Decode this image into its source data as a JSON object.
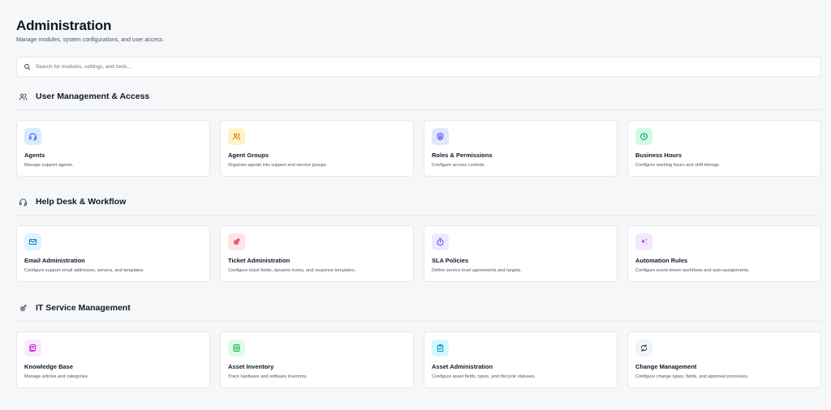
{
  "page": {
    "title": "Administration",
    "subtitle": "Manage modules, system configurations, and user access."
  },
  "search": {
    "placeholder": "Search for modules, settings, and tools..."
  },
  "sections": [
    {
      "title": "User Management & Access",
      "icon": "users-icon",
      "cards": [
        {
          "title": "Agents",
          "description": "Manage support agents.",
          "icon": "headset-icon",
          "bg": "#dbeafe",
          "color": "#2563eb"
        },
        {
          "title": "Agent Groups",
          "description": "Organize agents into support and service groups.",
          "icon": "user-group-icon",
          "bg": "#fef3c7",
          "color": "#d97706"
        },
        {
          "title": "Roles & Permissions",
          "description": "Configure access controls.",
          "icon": "shield-user-icon",
          "bg": "#e0e7ff",
          "color": "#4f46e5"
        },
        {
          "title": "Business Hours",
          "description": "Configure working hours and shift timings.",
          "icon": "clock-icon",
          "bg": "#d1fae5",
          "color": "#059669"
        }
      ]
    },
    {
      "title": "Help Desk & Workflow",
      "icon": "headset-icon",
      "cards": [
        {
          "title": "Email Administration",
          "description": "Configure support email addresses, servers, and templates.",
          "icon": "mail-icon",
          "bg": "#e0f2fe",
          "color": "#0284c7"
        },
        {
          "title": "Ticket Administration",
          "description": "Configure ticket fields, dynamic forms, and response templates.",
          "icon": "ticket-gear-icon",
          "bg": "#ffe4e6",
          "color": "#e11d48"
        },
        {
          "title": "SLA Policies",
          "description": "Define service level agreements and targets.",
          "icon": "timer-icon",
          "bg": "#ede9fe",
          "color": "#7c3aed"
        },
        {
          "title": "Automation Rules",
          "description": "Configure event-driven workflows and auto-assignments.",
          "icon": "sparkles-icon",
          "bg": "#f3e8ff",
          "color": "#9333ea"
        }
      ]
    },
    {
      "title": "IT Service Management",
      "icon": "cog-icon",
      "cards": [
        {
          "title": "Knowledge Base",
          "description": "Manage articles and categories.",
          "icon": "book-icon",
          "bg": "#fae8ff",
          "color": "#c026d3"
        },
        {
          "title": "Asset Inventory",
          "description": "Track hardware and software inventory.",
          "icon": "inventory-icon",
          "bg": "#dcfce7",
          "color": "#16a34a"
        },
        {
          "title": "Asset Administration",
          "description": "Configure asset fields, types, and lifecycle statuses.",
          "icon": "clipboard-icon",
          "bg": "#cffafe",
          "color": "#0891b2"
        },
        {
          "title": "Change Management",
          "description": "Configure change types, fields, and approval processes.",
          "icon": "refresh-icon",
          "bg": "#f1f5f9",
          "color": "#334155"
        }
      ]
    }
  ]
}
